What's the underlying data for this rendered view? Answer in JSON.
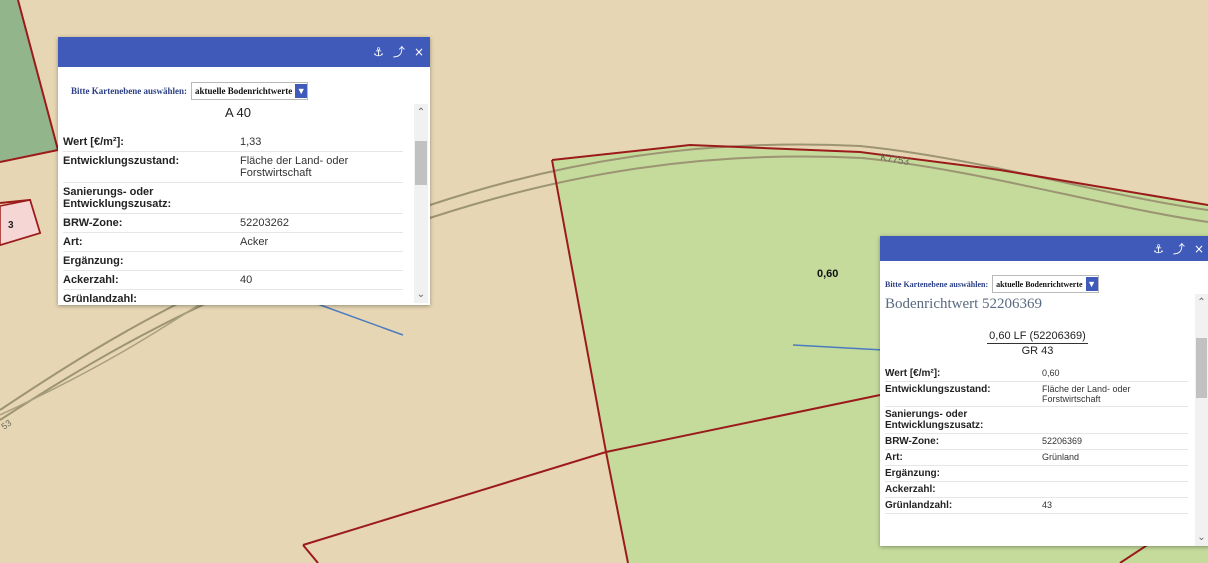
{
  "colors": {
    "map_bg": "#e7d6b4",
    "green_parcel": "#c4db9c",
    "green_left": "#93b58c",
    "road": "#9c9472",
    "parcel_border": "#9b1b1b",
    "popup_header": "#3f5ab8",
    "leader_line": "#4a7bc0"
  },
  "map": {
    "road_label_k": "K7753",
    "road_label_small": "53",
    "parcel_label_3": "3",
    "value_label": "0,60"
  },
  "popup1": {
    "header_icons": [
      "anchor-icon",
      "unpin-icon",
      "close-icon"
    ],
    "header_icon_glyphs": [
      "⚓",
      "⤴",
      "×"
    ],
    "layer_label": "Bitte Kartenebene auswählen:",
    "layer_value": "aktuelle Bodenrichtwerte",
    "title": "A 40",
    "rows": [
      {
        "key": "Wert [€/m²]:",
        "value": "1,33"
      },
      {
        "key": "Entwicklungszustand:",
        "value": "Fläche der Land- oder Forstwirtschaft"
      },
      {
        "key": "Sanierungs- oder Entwicklungszusatz:",
        "value": ""
      },
      {
        "key": "BRW-Zone:",
        "value": "52203262"
      },
      {
        "key": "Art:",
        "value": "Acker"
      },
      {
        "key": "Ergänzung:",
        "value": ""
      },
      {
        "key": "Ackerzahl:",
        "value": "40"
      },
      {
        "key": "Grünlandzahl:",
        "value": ""
      }
    ]
  },
  "popup2": {
    "header_icons": [
      "anchor-icon",
      "unpin-icon",
      "close-icon"
    ],
    "header_icon_glyphs": [
      "⚓",
      "⤴",
      "×"
    ],
    "layer_label": "Bitte Kartenebene auswählen:",
    "layer_value": "aktuelle Bodenrichtwerte",
    "title": "Bodenrichtwert 52206369",
    "formula_top": "0,60 LF (52206369)",
    "formula_bottom": "GR 43",
    "rows": [
      {
        "key": "Wert [€/m²]:",
        "value": "0,60"
      },
      {
        "key": "Entwicklungszustand:",
        "value": "Fläche der Land- oder Forstwirtschaft"
      },
      {
        "key": "Sanierungs- oder Entwicklungszusatz:",
        "value": ""
      },
      {
        "key": "BRW-Zone:",
        "value": "52206369"
      },
      {
        "key": "Art:",
        "value": "Grünland"
      },
      {
        "key": "Ergänzung:",
        "value": ""
      },
      {
        "key": "Ackerzahl:",
        "value": ""
      },
      {
        "key": "Grünlandzahl:",
        "value": "43"
      }
    ]
  }
}
